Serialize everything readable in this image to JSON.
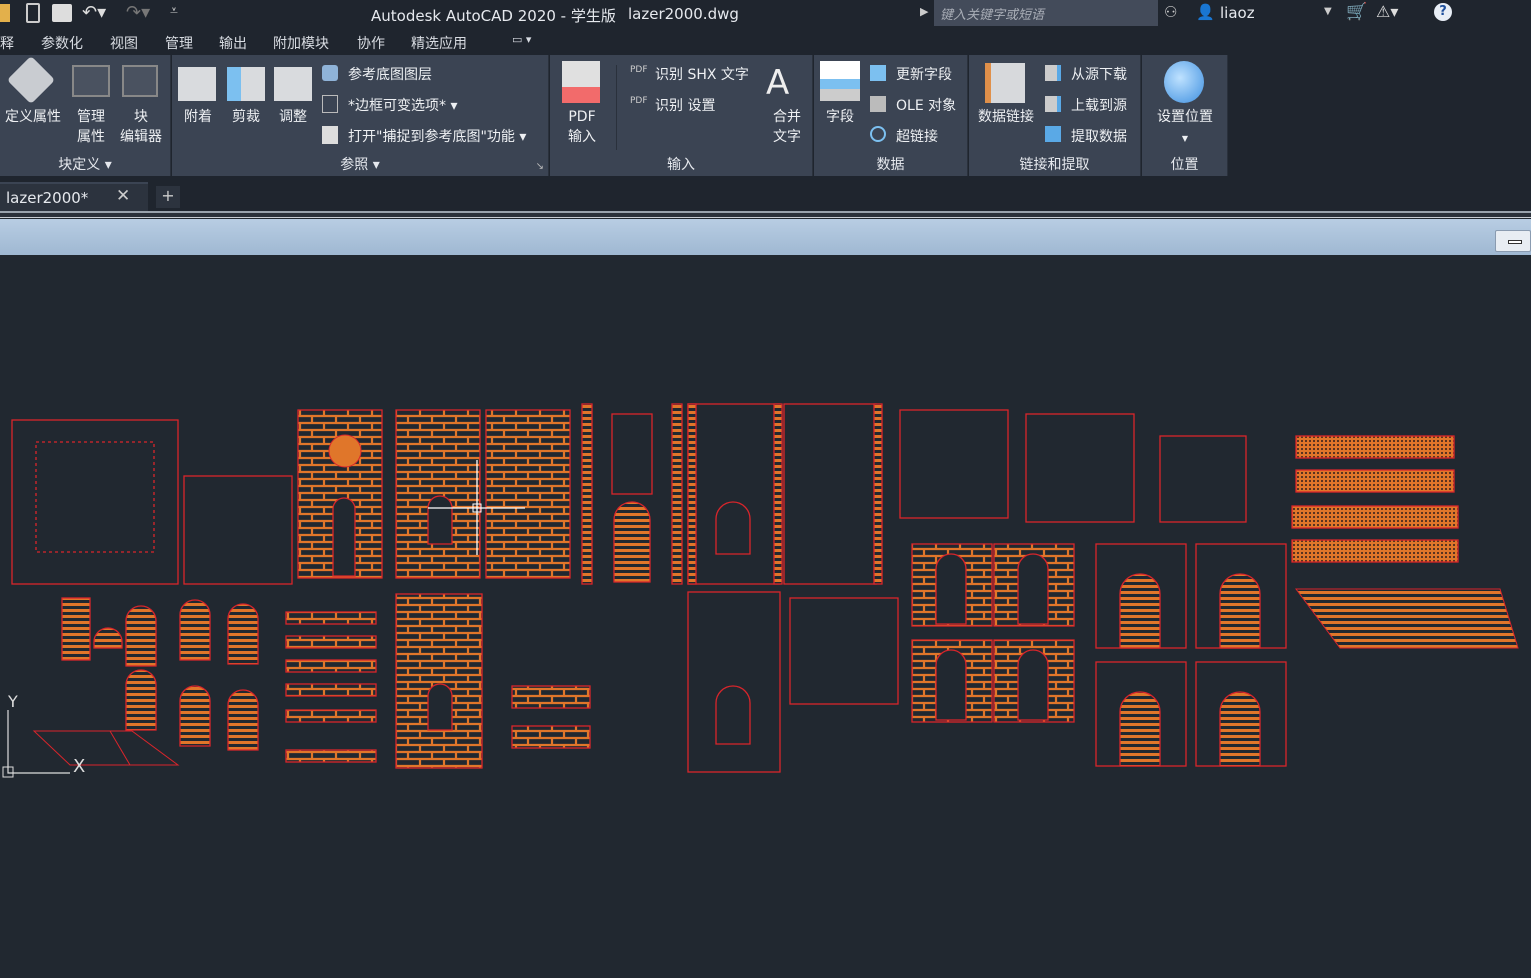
{
  "titlebar": {
    "app_title": "Autodesk AutoCAD 2020 - 学生版",
    "file_name": "lazer2000.dwg",
    "search_placeholder": "键入关键字或短语",
    "user": "liaoz"
  },
  "menu": [
    "释",
    "参数化",
    "视图",
    "管理",
    "输出",
    "附加模块",
    "协作",
    "精选应用"
  ],
  "ribbon": {
    "block_def": {
      "label": "块定义",
      "buttons": [
        "定义属性",
        "管理\n属性",
        "块\n编辑器"
      ]
    },
    "reference": {
      "label": "参照",
      "buttons": [
        "附着",
        "剪裁",
        "调整"
      ],
      "small": [
        "参考底图图层",
        "*边框可变选项*",
        "打开\"捕捉到参考底图\"功能"
      ]
    },
    "import": {
      "label": "输入",
      "pdf": "PDF\n输入",
      "small": [
        "识别 SHX 文字",
        "识别 设置"
      ],
      "merge": "合并\n文字"
    },
    "data": {
      "label": "数据",
      "field": "字段",
      "small": [
        "更新字段",
        "OLE 对象",
        "超链接"
      ]
    },
    "link": {
      "label": "链接和提取",
      "datalink": "数据链接",
      "small": [
        "从源下载",
        "上载到源",
        "提取数据"
      ]
    },
    "location": {
      "label": "位置",
      "set": "设置位置"
    }
  },
  "tabs": [
    {
      "label": "lazer2000*"
    }
  ],
  "canvas": {
    "axis_y": "Y",
    "axis_x": "X"
  },
  "colors": {
    "line": "#d9252b",
    "brick": "#e0762a",
    "background": "#212830",
    "ribbon": "#3b4453"
  }
}
